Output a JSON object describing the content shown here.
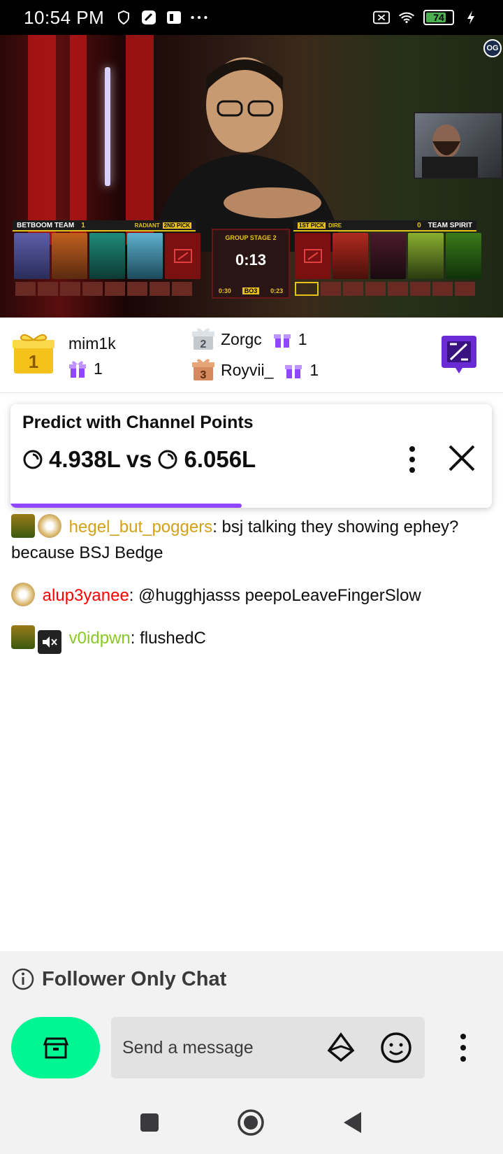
{
  "status_bar": {
    "time": "10:54 PM",
    "battery": "74",
    "icons": [
      "shield-icon",
      "app-icon",
      "gallery-icon",
      "more-dots-icon",
      "sim-off-icon",
      "wifi-icon",
      "battery-icon",
      "charging-icon"
    ]
  },
  "video": {
    "team_left": "BETBOOM TEAM",
    "team_left_score": "1",
    "team_left_side": "RADIANT",
    "team_left_pick": "2ND PICK",
    "team_right": "TEAM SPIRIT",
    "team_right_score": "0",
    "team_right_side": "DIRE",
    "team_right_pick": "1ST PICK",
    "stage": "GROUP STAGE 2",
    "timer": "0:13",
    "left_reserve": "0:30",
    "format": "BO3",
    "right_reserve": "0:23",
    "logo": "OG"
  },
  "gift_leaderboard": {
    "first": {
      "name": "mim1k",
      "count": "1",
      "rank": "1"
    },
    "second": {
      "name": "Zorgc",
      "count": "1",
      "rank": "2"
    },
    "third": {
      "name": "Royvii_",
      "count": "1",
      "rank": "3"
    }
  },
  "prediction": {
    "title": "Predict with Channel Points",
    "left_value": "4.938L",
    "vs": "vs",
    "right_value": "6.056L",
    "left_share": 0.48
  },
  "chat": [
    {
      "user": "hegel_but_poggers",
      "color": "#d4a017",
      "text": ": bsj talking they showing ephey? because BSJ Bedge",
      "badges": [
        "hero-badge",
        "predict-badge"
      ]
    },
    {
      "user": "alup3yanee",
      "color": "#ff0000",
      "text": ": @hugghjasss peepoLeaveFingerSlow",
      "badges": [
        "predict-badge"
      ]
    },
    {
      "user": "v0idpwn",
      "color": "#8ac924",
      "text": ": flushedC",
      "badges": [
        "hero-badge",
        "mute-badge"
      ]
    }
  ],
  "follower_only": "Follower Only Chat",
  "input": {
    "placeholder": "Send a message"
  }
}
